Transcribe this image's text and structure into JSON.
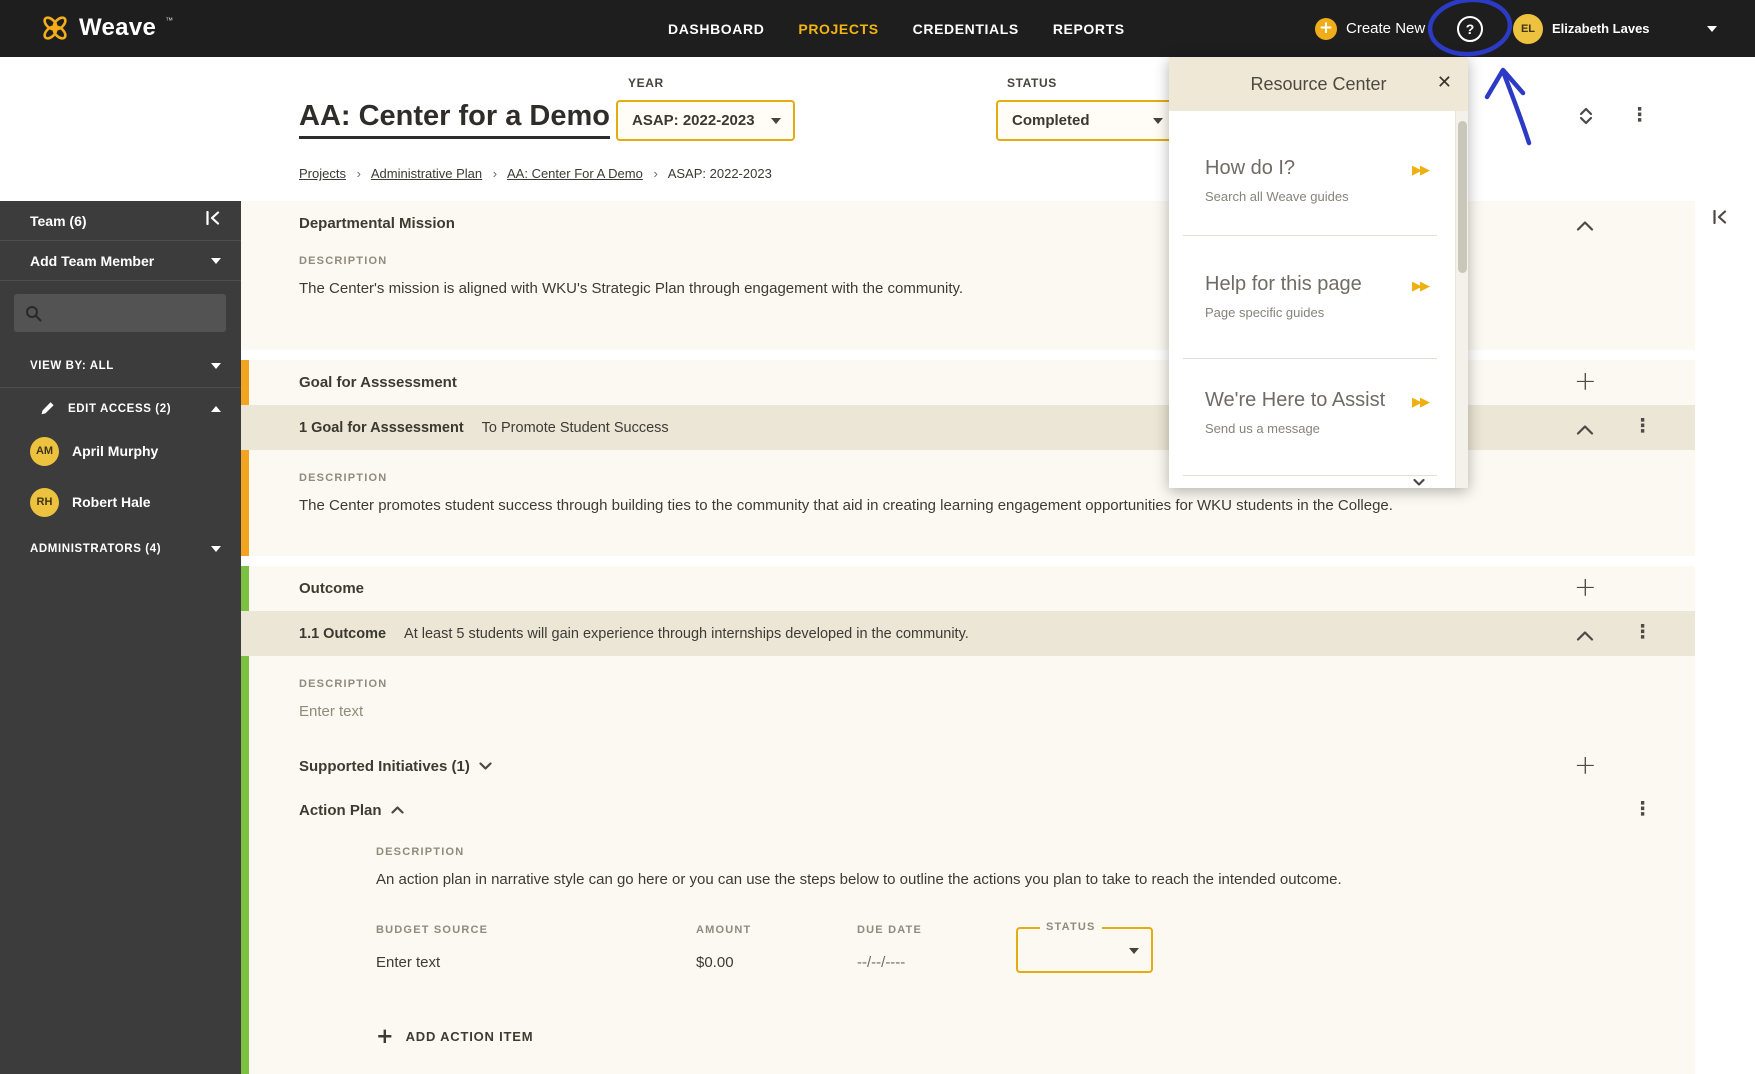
{
  "colors": {
    "accent_gold": "#f0ad1a",
    "goal_accent": "#f4a41f",
    "outcome_accent": "#7cc142",
    "annotation_blue": "#2c3bc6"
  },
  "icons": {
    "plus": "+",
    "kebab": "⋮",
    "close": "✕",
    "help": "?",
    "fast_forward": "▶▶"
  },
  "topnav": {
    "brand": "Weave",
    "brand_tm": "™",
    "items": [
      "DASHBOARD",
      "PROJECTS",
      "CREDENTIALS",
      "REPORTS"
    ],
    "create_new_label": "Create New",
    "user": {
      "initials": "EL",
      "name": "Elizabeth Laves"
    }
  },
  "header": {
    "title": "AA: Center for a Demo",
    "year": {
      "label": "YEAR",
      "value": "ASAP: 2022-2023"
    },
    "status": {
      "label": "STATUS",
      "value": "Completed"
    },
    "breadcrumb": [
      "Projects",
      "Administrative Plan",
      "AA: Center For A Demo",
      "ASAP: 2022-2023"
    ],
    "breadcrumb_separator": "›"
  },
  "sidebar": {
    "team_label": "Team (6)",
    "add_team_member_label": "Add Team Member",
    "view_by_label": "VIEW BY: ALL",
    "edit_access_label": "EDIT ACCESS (2)",
    "members": [
      {
        "initials": "AM",
        "name": "April Murphy"
      },
      {
        "initials": "RH",
        "name": "Robert Hale"
      }
    ],
    "administrators_label": "ADMINISTRATORS (4)"
  },
  "content": {
    "description_label": "DESCRIPTION",
    "departmental_mission": {
      "title": "Departmental Mission",
      "description": "The Center's mission is aligned with WKU's Strategic Plan through engagement with the community."
    },
    "goal": {
      "section_title": "Goal for Asssessment",
      "item_title": "1 Goal for Asssessment",
      "item_text": "To Promote Student Success",
      "description": "The Center promotes student success through building ties to the community that aid in creating learning engagement opportunities for WKU students in the College."
    },
    "outcome": {
      "section_title": "Outcome",
      "item_title": "1.1 Outcome",
      "item_text": "At least 5 students will gain experience through internships developed in the community.",
      "description_placeholder": "Enter text"
    },
    "supported_initiatives": {
      "title": "Supported Initiatives (1)"
    },
    "action_plan": {
      "title": "Action Plan",
      "description": "An action plan in narrative style can go here or you can use the steps below to outline the actions you plan to take to reach the intended outcome.",
      "budget_source_label": "BUDGET SOURCE",
      "budget_source_placeholder": "Enter text",
      "amount_label": "AMOUNT",
      "amount_value": "$0.00",
      "due_date_label": "DUE DATE",
      "due_date_value": "--/--/----",
      "status_label": "STATUS",
      "add_action_item_label": "ADD ACTION ITEM"
    }
  },
  "resource_center": {
    "title": "Resource Center",
    "items": [
      {
        "title": "How do I?",
        "subtitle": "Search all Weave guides"
      },
      {
        "title": "Help for this page",
        "subtitle": "Page specific guides"
      },
      {
        "title": "We're Here to Assist",
        "subtitle": "Send us a message"
      }
    ]
  }
}
